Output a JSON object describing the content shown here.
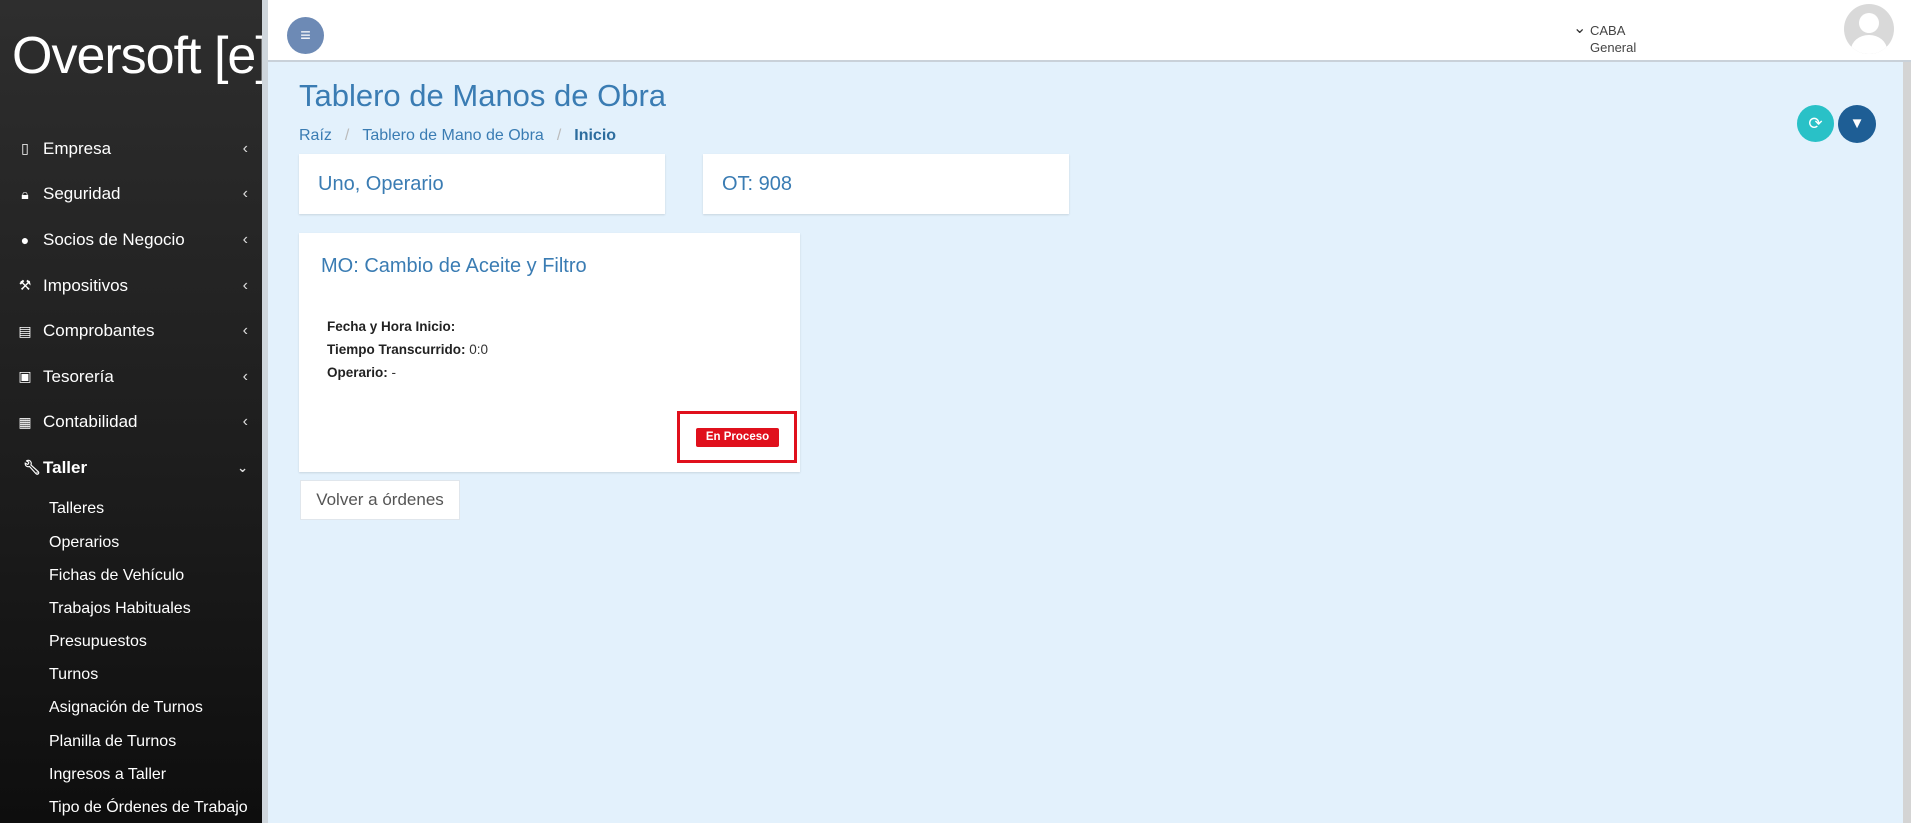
{
  "sidebar": {
    "logo": "Oversoft [e]",
    "items": [
      {
        "label": "Empresa",
        "icon": "building-icon"
      },
      {
        "label": "Seguridad",
        "icon": "lock-icon"
      },
      {
        "label": "Socios de Negocio",
        "icon": "user-icon"
      },
      {
        "label": "Impositivos",
        "icon": "gavel-icon"
      },
      {
        "label": "Comprobantes",
        "icon": "document-icon"
      },
      {
        "label": "Tesorería",
        "icon": "money-icon"
      },
      {
        "label": "Contabilidad",
        "icon": "calculator-icon"
      },
      {
        "label": "Taller",
        "icon": "wrench-icon"
      }
    ],
    "taller_sub": [
      "Talleres",
      "Operarios",
      "Fichas de Vehículo",
      "Trabajos Habituales",
      "Presupuestos",
      "Turnos",
      "Asignación de Turnos",
      "Planilla de Turnos",
      "Ingresos a Taller",
      "Tipo de Órdenes de Trabajo"
    ]
  },
  "header": {
    "location": "CABA",
    "sublocation": "General"
  },
  "main": {
    "title": "Tablero de Manos de Obra",
    "breadcrumb": [
      "Raíz",
      "Tablero de Mano de Obra",
      "Inicio"
    ],
    "operator_card": "Uno, Operario",
    "ot_card": "OT: 908",
    "mo_card": {
      "title": "MO: Cambio de Aceite y Filtro",
      "fecha_label": "Fecha y Hora Inicio:",
      "fecha_value": "",
      "tiempo_label": "Tiempo Transcurrido:",
      "tiempo_value": "0:0",
      "operario_label": "Operario:",
      "operario_value": "-",
      "status": "En Proceso"
    },
    "back_button": "Volver a órdenes"
  },
  "colors": {
    "accent": "#3a7cb3",
    "status": "#e0101c",
    "background": "#e3f1fc"
  }
}
